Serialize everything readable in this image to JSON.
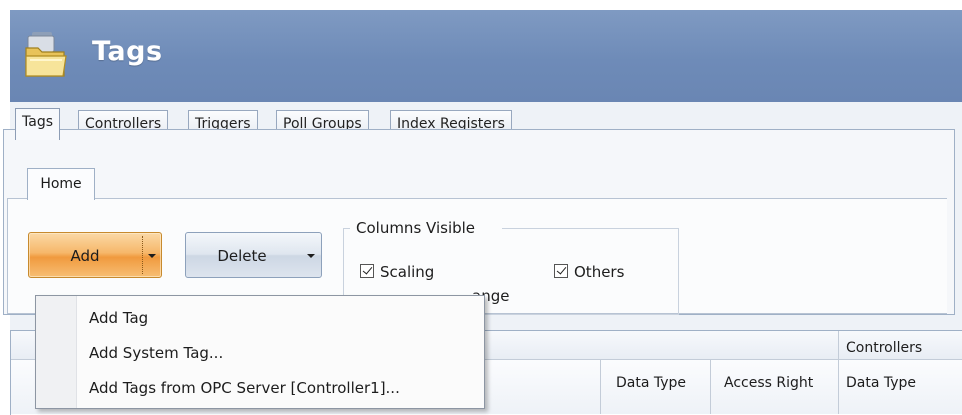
{
  "header": {
    "title": "Tags",
    "icon": "tags-folder-icon"
  },
  "tabs": [
    {
      "label": "Tags",
      "active": true
    },
    {
      "label": "Controllers",
      "active": false
    },
    {
      "label": "Triggers",
      "active": false
    },
    {
      "label": "Poll Groups",
      "active": false
    },
    {
      "label": "Index Registers",
      "active": false
    }
  ],
  "ribbon": {
    "home_tab": "Home",
    "add_button": "Add",
    "delete_button": "Delete",
    "columns_visible": {
      "title": "Columns Visible",
      "scaling": {
        "label": "Scaling",
        "checked": true
      },
      "others": {
        "label": "Others",
        "checked": true
      },
      "hidden_label_fragment": "ange"
    }
  },
  "add_menu": {
    "items": [
      "Add Tag",
      "Add System Tag...",
      "Add Tags from OPC Server [Controller1]..."
    ]
  },
  "grid": {
    "group_header": "Controllers",
    "columns": [
      "Data Type",
      "Access Right",
      "Data Type"
    ]
  },
  "colors": {
    "header_bg": "#6e8bb8",
    "add_button": "#f6b76a",
    "delete_button": "#dfe6ef"
  }
}
